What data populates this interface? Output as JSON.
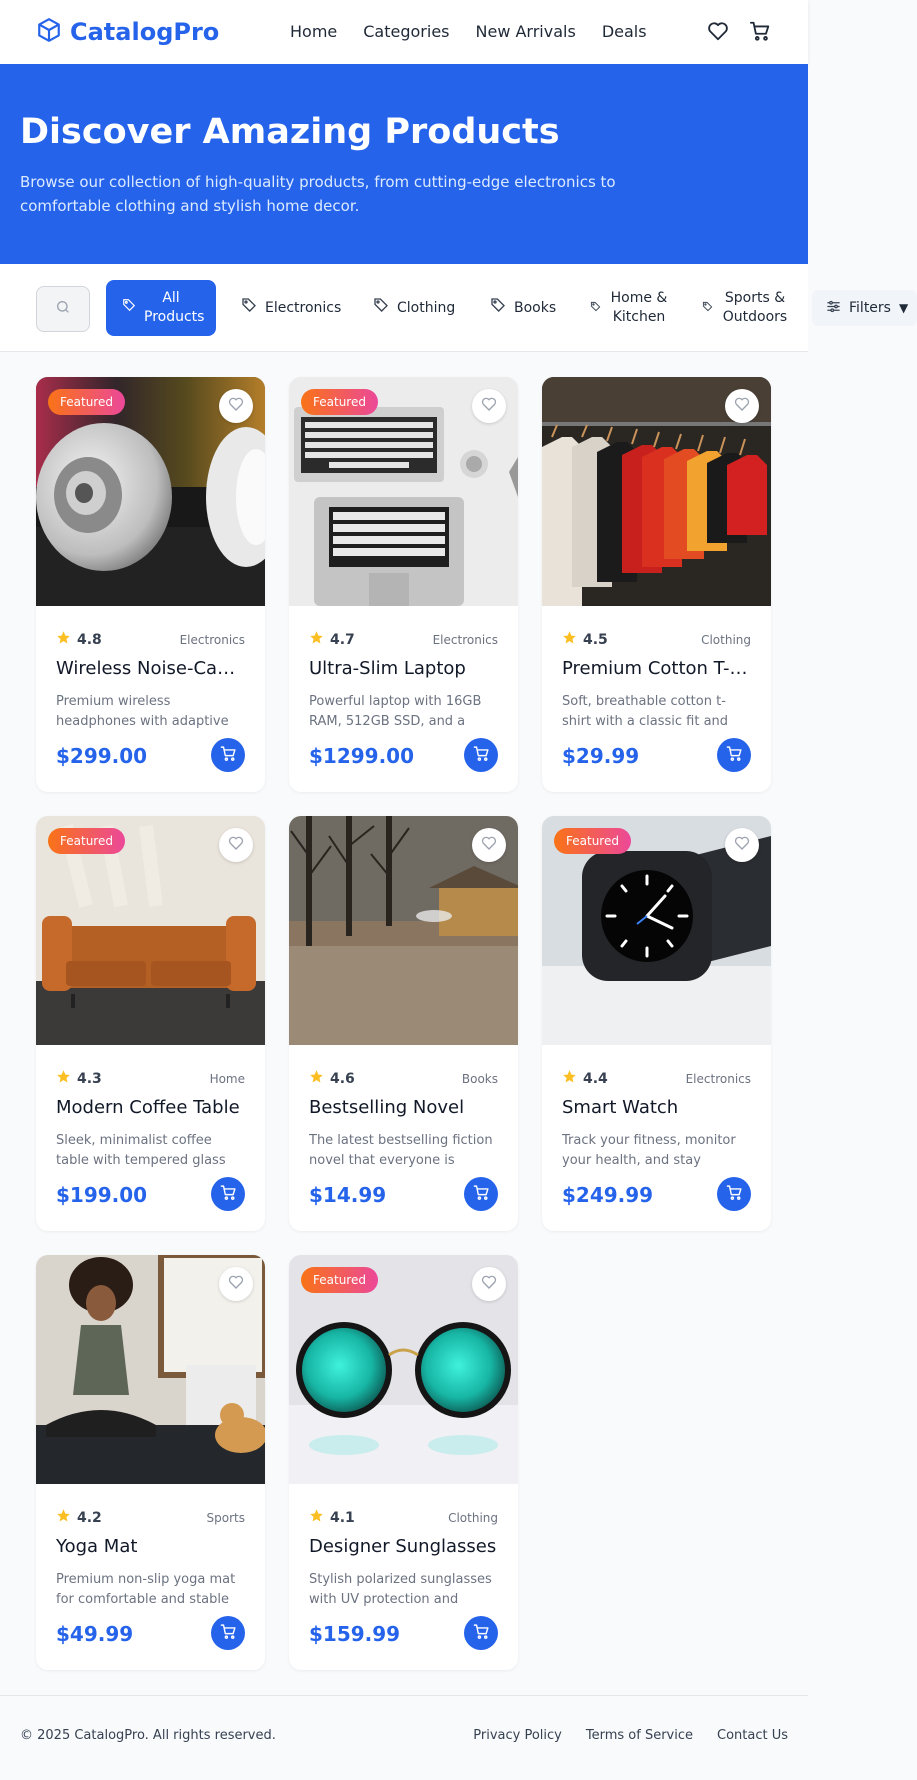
{
  "header": {
    "logo_text": "CatalogPro",
    "nav": [
      "Home",
      "Categories",
      "New Arrivals",
      "Deals"
    ],
    "accent_color": "#2563eb"
  },
  "hero": {
    "title": "Discover Amazing Products",
    "subtitle": "Browse our collection of high-quality products, from cutting-edge electronics to comfortable clothing and stylish home decor."
  },
  "filters": {
    "categories": [
      {
        "label": "All Products",
        "active": true
      },
      {
        "label": "Electronics",
        "active": false
      },
      {
        "label": "Clothing",
        "active": false
      },
      {
        "label": "Books",
        "active": false
      },
      {
        "label": "Home & Kitchen",
        "active": false
      },
      {
        "label": "Sports & Outdoors",
        "active": false
      }
    ],
    "filters_label": "Filters"
  },
  "products": [
    {
      "name": "Wireless Noise-Cancelling Headphones",
      "rating": "4.8",
      "category": "Electronics",
      "description": "Premium wireless headphones with adaptive noise cancellation",
      "price": "$299.00",
      "featured": true,
      "badge": "Featured"
    },
    {
      "name": "Ultra-Slim Laptop",
      "rating": "4.7",
      "category": "Electronics",
      "description": "Powerful laptop with 16GB RAM, 512GB SSD, and a stunning display",
      "price": "$1299.00",
      "featured": true,
      "badge": "Featured"
    },
    {
      "name": "Premium Cotton T-Shirt",
      "rating": "4.5",
      "category": "Clothing",
      "description": "Soft, breathable cotton t-shirt with a classic fit and timeless style",
      "price": "$29.99",
      "featured": false,
      "badge": ""
    },
    {
      "name": "Modern Coffee Table",
      "rating": "4.3",
      "category": "Home",
      "description": "Sleek, minimalist coffee table with tempered glass top and oak legs",
      "price": "$199.00",
      "featured": true,
      "badge": "Featured"
    },
    {
      "name": "Bestselling Novel",
      "rating": "4.6",
      "category": "Books",
      "description": "The latest bestselling fiction novel that everyone is talking about",
      "price": "$14.99",
      "featured": false,
      "badge": ""
    },
    {
      "name": "Smart Watch",
      "rating": "4.4",
      "category": "Electronics",
      "description": "Track your fitness, monitor your health, and stay connected",
      "price": "$249.99",
      "featured": true,
      "badge": "Featured"
    },
    {
      "name": "Yoga Mat",
      "rating": "4.2",
      "category": "Sports",
      "description": "Premium non-slip yoga mat for comfortable and stable practice",
      "price": "$49.99",
      "featured": false,
      "badge": ""
    },
    {
      "name": "Designer Sunglasses",
      "rating": "4.1",
      "category": "Clothing",
      "description": "Stylish polarized sunglasses with UV protection and metal frame",
      "price": "$159.99",
      "featured": true,
      "badge": "Featured"
    }
  ],
  "footer": {
    "copyright": "© 2025 CatalogPro. All rights reserved.",
    "links": [
      "Privacy Policy",
      "Terms of Service",
      "Contact Us"
    ]
  }
}
